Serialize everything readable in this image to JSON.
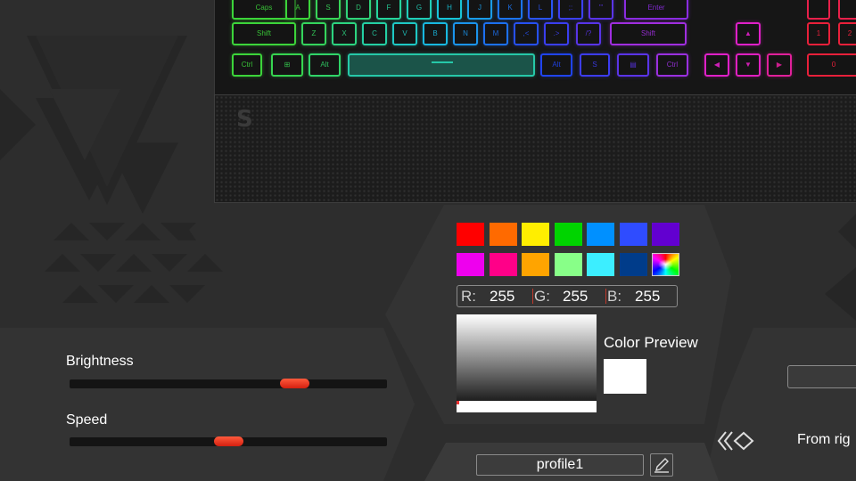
{
  "keyboard": {
    "rows": [
      {
        "keys": [
          {
            "label": "Caps",
            "color": "#3cd43a"
          },
          {
            "label": "A",
            "color": "#3cd43a"
          },
          {
            "label": "S",
            "color": "#38d458"
          },
          {
            "label": "D",
            "color": "#30d47a"
          },
          {
            "label": "F",
            "color": "#26d49c"
          },
          {
            "label": "G",
            "color": "#20ceb8"
          },
          {
            "label": "H",
            "color": "#18c4d8"
          },
          {
            "label": "J",
            "color": "#1a9ce8"
          },
          {
            "label": "K",
            "color": "#1c74f0"
          },
          {
            "label": "L",
            "color": "#2a54f4"
          },
          {
            "label": ";:",
            "color": "#3c40f0"
          },
          {
            "label": "'\"",
            "color": "#5a34e8"
          },
          {
            "label": "Enter",
            "color": "#8a2ce0"
          }
        ]
      },
      {
        "keys": [
          {
            "label": "Shift",
            "color": "#3cd43a"
          },
          {
            "label": "Z",
            "color": "#34d45c"
          },
          {
            "label": "X",
            "color": "#2cd480"
          },
          {
            "label": "C",
            "color": "#24d0a4"
          },
          {
            "label": "V",
            "color": "#1ec8c4"
          },
          {
            "label": "B",
            "color": "#18b8e0"
          },
          {
            "label": "N",
            "color": "#1a94ec"
          },
          {
            "label": "M",
            "color": "#1c70f0"
          },
          {
            "label": ",<",
            "color": "#2650f2"
          },
          {
            "label": ".>",
            "color": "#3a3ef0"
          },
          {
            "label": "/?",
            "color": "#5834e8"
          },
          {
            "label": "Shift",
            "color": "#a02ee0"
          },
          {
            "label": "▲",
            "color": "#e020c8"
          }
        ]
      },
      {
        "keys": [
          {
            "label": "Ctrl",
            "color": "#3cd43a"
          },
          {
            "label": "⊞",
            "color": "#36d450"
          },
          {
            "label": "Alt",
            "color": "#30d468"
          },
          {
            "label": "",
            "color": "#26c8a8"
          },
          {
            "label": "Alt",
            "color": "#2044f0"
          },
          {
            "label": "S",
            "color": "#3c3cf0"
          },
          {
            "label": "▤",
            "color": "#5a34e8"
          },
          {
            "label": "Ctrl",
            "color": "#9a30e0"
          },
          {
            "label": "◀",
            "color": "#e020c8"
          },
          {
            "label": "▼",
            "color": "#e020c0"
          },
          {
            "label": "▶",
            "color": "#e0209a"
          }
        ]
      }
    ],
    "numpad": [
      {
        "label": "",
        "color": "#e8204a"
      },
      {
        "label": "",
        "color": "#e8204a"
      },
      {
        "label": "1",
        "color": "#e8203a"
      },
      {
        "label": "2",
        "color": "#e8203a"
      },
      {
        "label": "0",
        "color": "#e8203a"
      }
    ]
  },
  "palmrest": {
    "logo": "S"
  },
  "controls": {
    "brightness": {
      "label": "Brightness",
      "value": 0.73
    },
    "speed": {
      "label": "Speed",
      "value": 0.5
    }
  },
  "palette": {
    "colors": [
      "#ff0000",
      "#ff6a00",
      "#ffee00",
      "#00d400",
      "#0090ff",
      "#2f4cff",
      "#6200d0",
      "#ee00ee",
      "#ff0088",
      "#ffa400",
      "#88ff88",
      "#3ceeff",
      "#003c8a"
    ],
    "custom_icon": "color-wheel-icon"
  },
  "rgb": {
    "r_label": "R:",
    "r": "255",
    "g_label": "G:",
    "g": "255",
    "b_label": "B:",
    "b": "255"
  },
  "preview": {
    "label": "Color Preview",
    "color": "#ffffff"
  },
  "profile": {
    "name": "profile1",
    "edit_icon": "pencil-icon"
  },
  "direction": {
    "label": "From rig",
    "icon": "arrows-left-icon"
  }
}
